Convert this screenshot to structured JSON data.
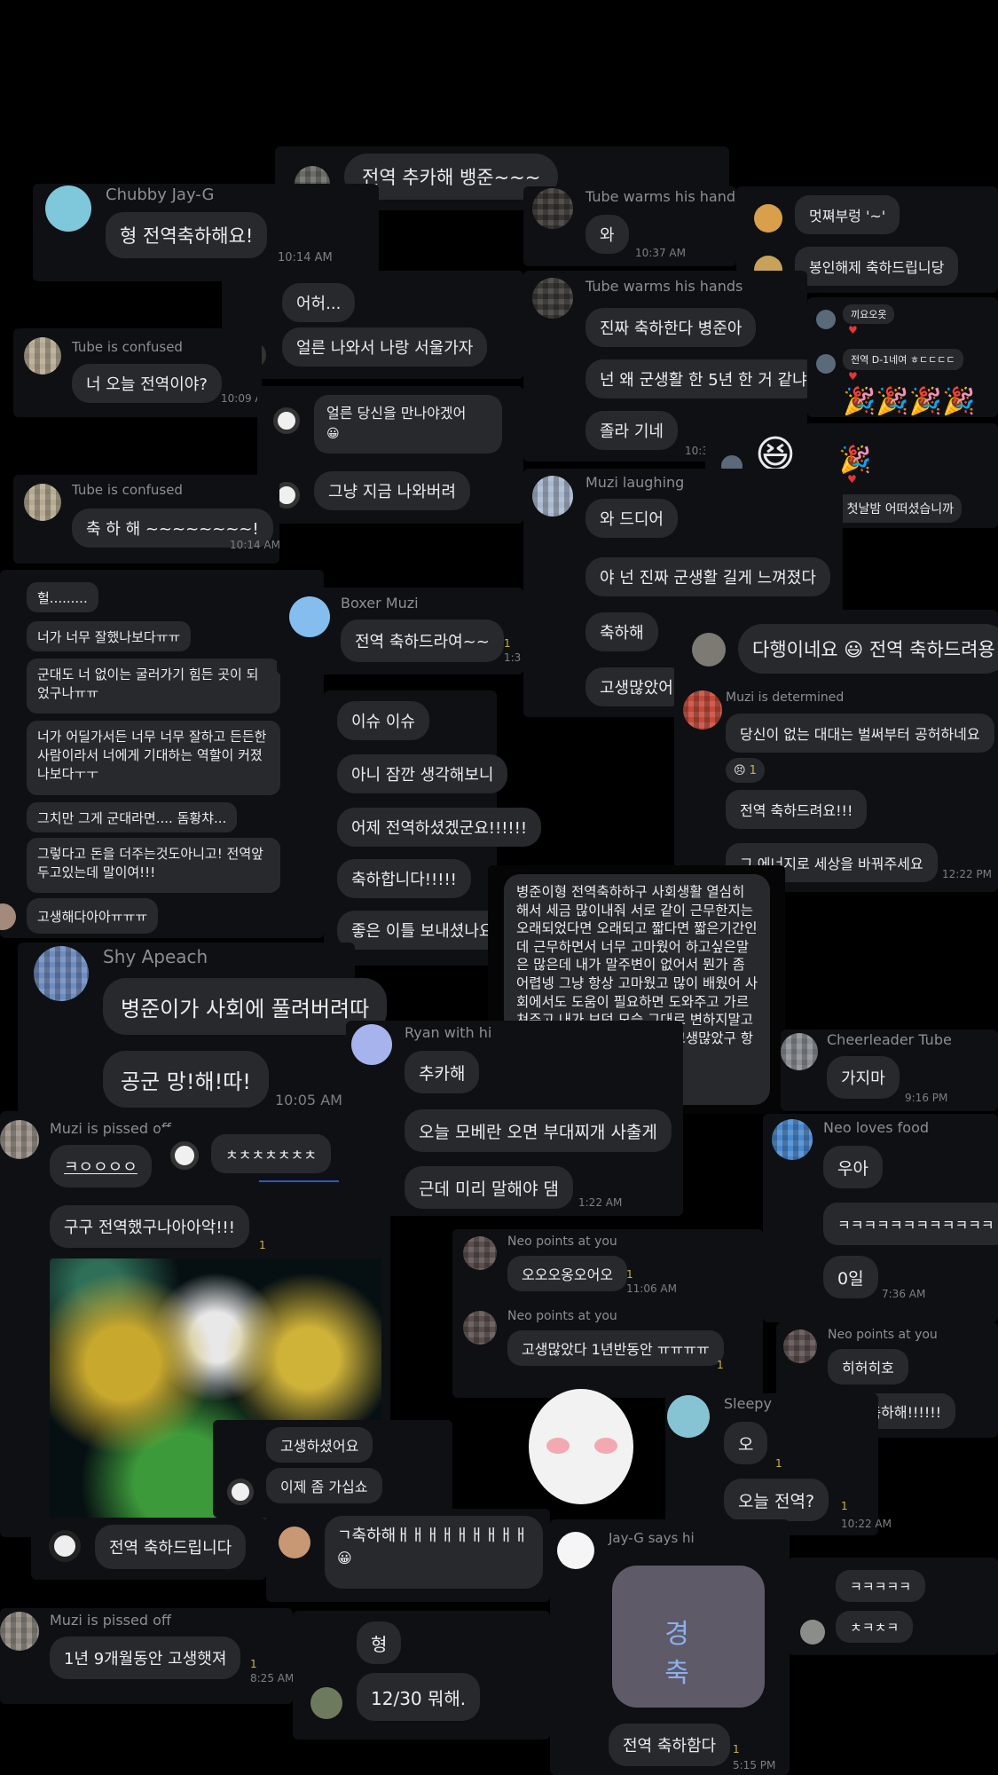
{
  "screenshot_type": "kakaotalk-chat-collage",
  "colors": {
    "background": "#000000",
    "panel": "#0f1013",
    "bubble": "#28292d",
    "unread": "#c9b44a"
  },
  "c1": {
    "text": "전역 추카해 뱅준~~~"
  },
  "c2": {
    "name": "Chubby Jay-G",
    "text": "형 전역축하해요!",
    "time": "10:14 AM"
  },
  "c3": {
    "name": "Tube warms his hands",
    "text": "와",
    "time": "10:37 AM"
  },
  "c4": {
    "text1": "멋쪄부렁 '~'",
    "text2": "봉인해제 축하드립니당"
  },
  "c5": {
    "text1": "어허...",
    "text2": "얼른 나와서 나랑 서울가자"
  },
  "c6": {
    "name": "Tube warms his hands",
    "text1": "진짜 축하한다 병준아",
    "text2": "넌 왜 군생활 한 5년 한 거 같냐",
    "text3": "졸라 기네",
    "time": "10:3"
  },
  "c7": {
    "text1": "끼요오옷",
    "text2": "전역 D-1네여 ㅎㄷㄷㄷㄷ",
    "text3": "사회인으로서의 첫날밤 어떠셨습니까"
  },
  "c8": {
    "name": "Tube is confused",
    "text": "너 오늘 전역이야?",
    "time": "10:09 A"
  },
  "c9": {
    "text1": "얼른 당신을 만나야겠어",
    "text2": "그냥 지금 나와버려"
  },
  "c10": {
    "name": "Tube is confused",
    "text": "축 하 해 ~~~~~~~~!",
    "time": "10:14 AM"
  },
  "c11": {
    "name": "Muzi laughing",
    "text1": "와 드디어",
    "text2": "야 넌 진짜 군생활 길게 느껴졌다",
    "text3": "축하해",
    "text4": "고생많았어"
  },
  "c12": {
    "lines": [
      "헐.........",
      "너가 너무 잘했나보다ㅠㅠ",
      "군대도 너 없이는 굴러가기 힘든 곳이 되었구나ㅠㅠ",
      "너가 어딜가서든 너무 너무 잘하고 든든한 사람이라서 너에게 기대하는 역할이 커졌나보다ㅜㅜ",
      "그치만 그게 군대라면.... 돔황챠...",
      "그렇다고 돈을 더주는것도아니고! 전역앞두고있는데 말이여!!!",
      "고생해다아아ㅠㅠㅠ"
    ]
  },
  "c13": {
    "name": "Boxer Muzi",
    "text": "전역 축하드라여~~",
    "unread": "1",
    "time": "1:3"
  },
  "c14": {
    "text": "다행이네요 😃 전역 축하드려용"
  },
  "c15": {
    "name": "Muzi is determined",
    "text1": "당신이 없는 대대는 벌써부터 공허하네요",
    "reaction_count": "1",
    "text2": "전역 축하드려요!!!",
    "text3": "그 에너지로 세상을 바꿔주세요",
    "time": "12:22 PM"
  },
  "c16": {
    "lines": [
      "이슈 이슈",
      "아니 잠깐 생각해보니",
      "어제 전역하셨겠군요!!!!!!",
      "축하합니다!!!!!",
      "좋은 이틀 보내셨나요"
    ]
  },
  "c17": {
    "text": "병준이형 전역축하하구 사회생활 열심히 해서 세금 많이내줘 서로 같이 근무한지는 오래되었다면 오래되고 짧다면 짧은기간인데 근무하면서 너무 고마웠어 하고싶은말은 많은데 내가 말주변이 없어서 뭔가 좀 어렵넹 그냥 항상 고마웠고 많이 배웠어 사회에서도 도움이 필요하면 도와주고 가르쳐주고 내가 보던 모습 그대로 변하지말고 쭉 지내줘 고마웠어 군생활 고생많았구 항상 행복하길 바랄게~"
  },
  "c18": {
    "name": "Shy Apeach",
    "text1": "병준이가 사회에 풀려버려따",
    "text2": "공군 망!해!따!",
    "time": "10:05 AM"
  },
  "c19": {
    "name": "Ryan with hi",
    "text1": "추카해",
    "text2": "오늘 모베란 오면 부대찌개 사출게",
    "text3": "근데 미리 말해야 댐",
    "time": "1:22 AM"
  },
  "c20": {
    "name": "Cheerleader Tube",
    "text": "가지마",
    "time": "9:16 PM"
  },
  "c21": {
    "name": "Muzi is pissed off",
    "text1": "ㅋㅇㅇㅇㅇ",
    "text2": "구구 전역했구나아아악!!!",
    "unread": "1"
  },
  "c22": {
    "text": "ㅊㅊㅊㅊㅊㅊㅊ"
  },
  "c23": {
    "name": "Neo loves food",
    "text1": "우아",
    "text2": "ㅋㅋㅋㅋㅋㅋㅋㅋㅋㅋㅋㅋ",
    "text3": "0일",
    "time": "7:36 AM"
  },
  "c24": {
    "name": "Neo points at you",
    "text": "오오오옹오어오",
    "unread": "1",
    "time": "11:06 AM"
  },
  "c25": {
    "name": "Neo points at you",
    "text": "고생많았다 1년반동안 ㅠㅠㅠㅠ",
    "unread": "1"
  },
  "c26": {
    "name": "Neo points at you",
    "text1": "히허히호",
    "text2": "전역축하해!!!!!!"
  },
  "c27": {
    "text1": "고생하셨어요",
    "text2": "이제 좀 가십쇼"
  },
  "c28": {
    "name": "Sleepy",
    "text1": "오",
    "text2": "오늘 전역?",
    "unread1": "1",
    "unread2": "1",
    "time": "10:22 AM"
  },
  "c29": {
    "text": "전역 축하드립니다"
  },
  "c30": {
    "text": "ㄱ축하해ㅐㅐㅐㅐㅐㅐㅐㅐㅐ"
  },
  "c31": {
    "name": "Jay-G says hi",
    "sticker_text": "경 축",
    "text": "전역 축하함다",
    "unread": "1",
    "time": "5:15 PM"
  },
  "c32": {
    "text1": "ㅋㅋㅋㅋㅋ",
    "text2": "ㅊㅋㅊㅋ"
  },
  "c33": {
    "name": "Muzi is pissed off",
    "text": "1년 9개월동안 고생햇져",
    "unread": "1",
    "time": "8:25 AM"
  },
  "c34": {
    "text1": "형",
    "text2": "12/30 뭐해."
  }
}
